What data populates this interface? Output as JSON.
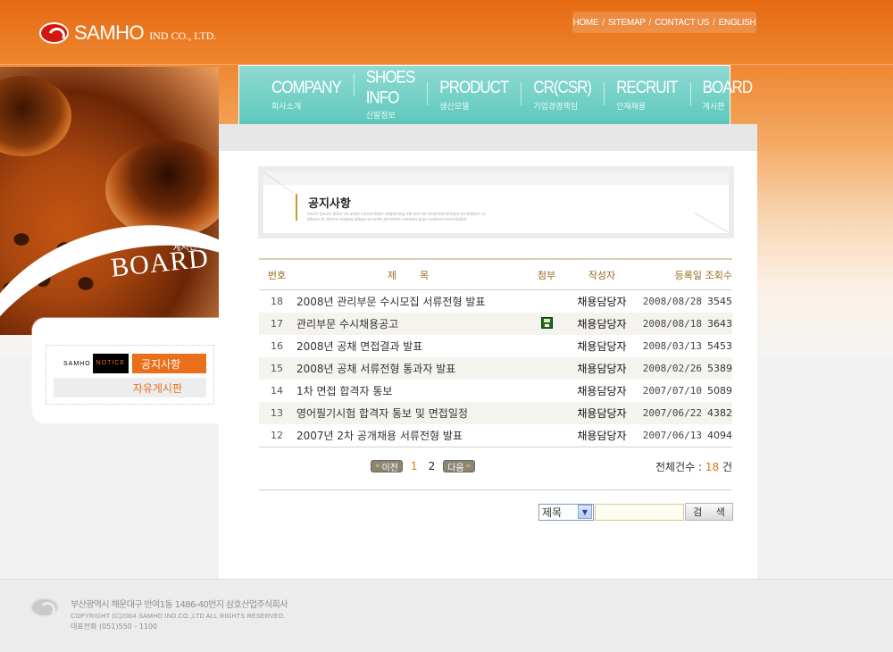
{
  "header": {
    "logo_name": "SAMHO",
    "logo_sub": "IND CO., LTD.",
    "utility_nav": [
      "HOME",
      "SITEMAP",
      "CONTACT US",
      "ENGLISH"
    ]
  },
  "gnb": [
    {
      "en": "COMPANY",
      "kr": "회사소개"
    },
    {
      "en": "SHOES INFO",
      "kr": "신발정보"
    },
    {
      "en": "PRODUCT",
      "kr": "생산모델"
    },
    {
      "en": "CR(CSR)",
      "kr": "기업경영책임"
    },
    {
      "en": "RECRUIT",
      "kr": "인재채용"
    },
    {
      "en": "BOARD",
      "kr": "게시판"
    }
  ],
  "hero": {
    "title": "BOARD",
    "subtitle": "게시판"
  },
  "lnb": {
    "notice_badge_prefix": "SAMHO",
    "notice_badge_highlight": "NOTICE",
    "items": [
      "공지사항",
      "자유게시판"
    ]
  },
  "page": {
    "title": "공지사항",
    "deco_text": "lorem ipsum dolor sit amet consectetur adipiscing elit sed do eiusmod tempor incididunt ut labore et dolore magna aliqua ut enim ad minim veniam quis nostrud exercitation"
  },
  "board": {
    "headers": {
      "no": "번호",
      "title": "제목",
      "attach": "첨부",
      "writer": "작성자",
      "date": "등록일",
      "hits": "조회수"
    },
    "rows": [
      {
        "no": "18",
        "title": "2008년 관리부문 수시모집 서류전형 발표",
        "attach": false,
        "writer": "채용담당자",
        "date": "2008/08/28",
        "hits": "3545"
      },
      {
        "no": "17",
        "title": "관리부문 수시채용공고",
        "attach": true,
        "writer": "채용담당자",
        "date": "2008/08/18",
        "hits": "3643"
      },
      {
        "no": "16",
        "title": "2008년 공채 면접결과 발표",
        "attach": false,
        "writer": "채용담당자",
        "date": "2008/03/13",
        "hits": "5453"
      },
      {
        "no": "15",
        "title": "2008년 공채 서류전형 통과자 발표",
        "attach": false,
        "writer": "채용담당자",
        "date": "2008/02/26",
        "hits": "5389"
      },
      {
        "no": "14",
        "title": "1차 면접 합격자 통보",
        "attach": false,
        "writer": "채용담당자",
        "date": "2007/07/10",
        "hits": "5089"
      },
      {
        "no": "13",
        "title": "영어필기시험 합격자 통보 및 면접일정",
        "attach": false,
        "writer": "채용담당자",
        "date": "2007/06/22",
        "hits": "4382"
      },
      {
        "no": "12",
        "title": "2007년 2차 공개채용 서류전형 발표",
        "attach": false,
        "writer": "채용담당자",
        "date": "2007/06/13",
        "hits": "4094"
      }
    ]
  },
  "paging": {
    "prev_label": "이전",
    "next_label": "다음",
    "pages": [
      "1",
      "2"
    ],
    "current": "1",
    "total_label": "전체건수 :",
    "total_count": "18",
    "total_unit": "건"
  },
  "search": {
    "select_value": "제목",
    "button_label": "검 색"
  },
  "footer": {
    "address": "부산광역시 해운대구 반여1동 1486-40번지 삼호산업주식회사",
    "copyright": "COPYRIGHT (C)2004 SAMHO IND.CO.,LTD ALL RIGHTS RESERVED.",
    "tel": "대표전화 (051)550 - 1100"
  },
  "colors": {
    "accent": "#e96f1a",
    "gnb": "#5ec8bc",
    "header": "#e56a12"
  }
}
